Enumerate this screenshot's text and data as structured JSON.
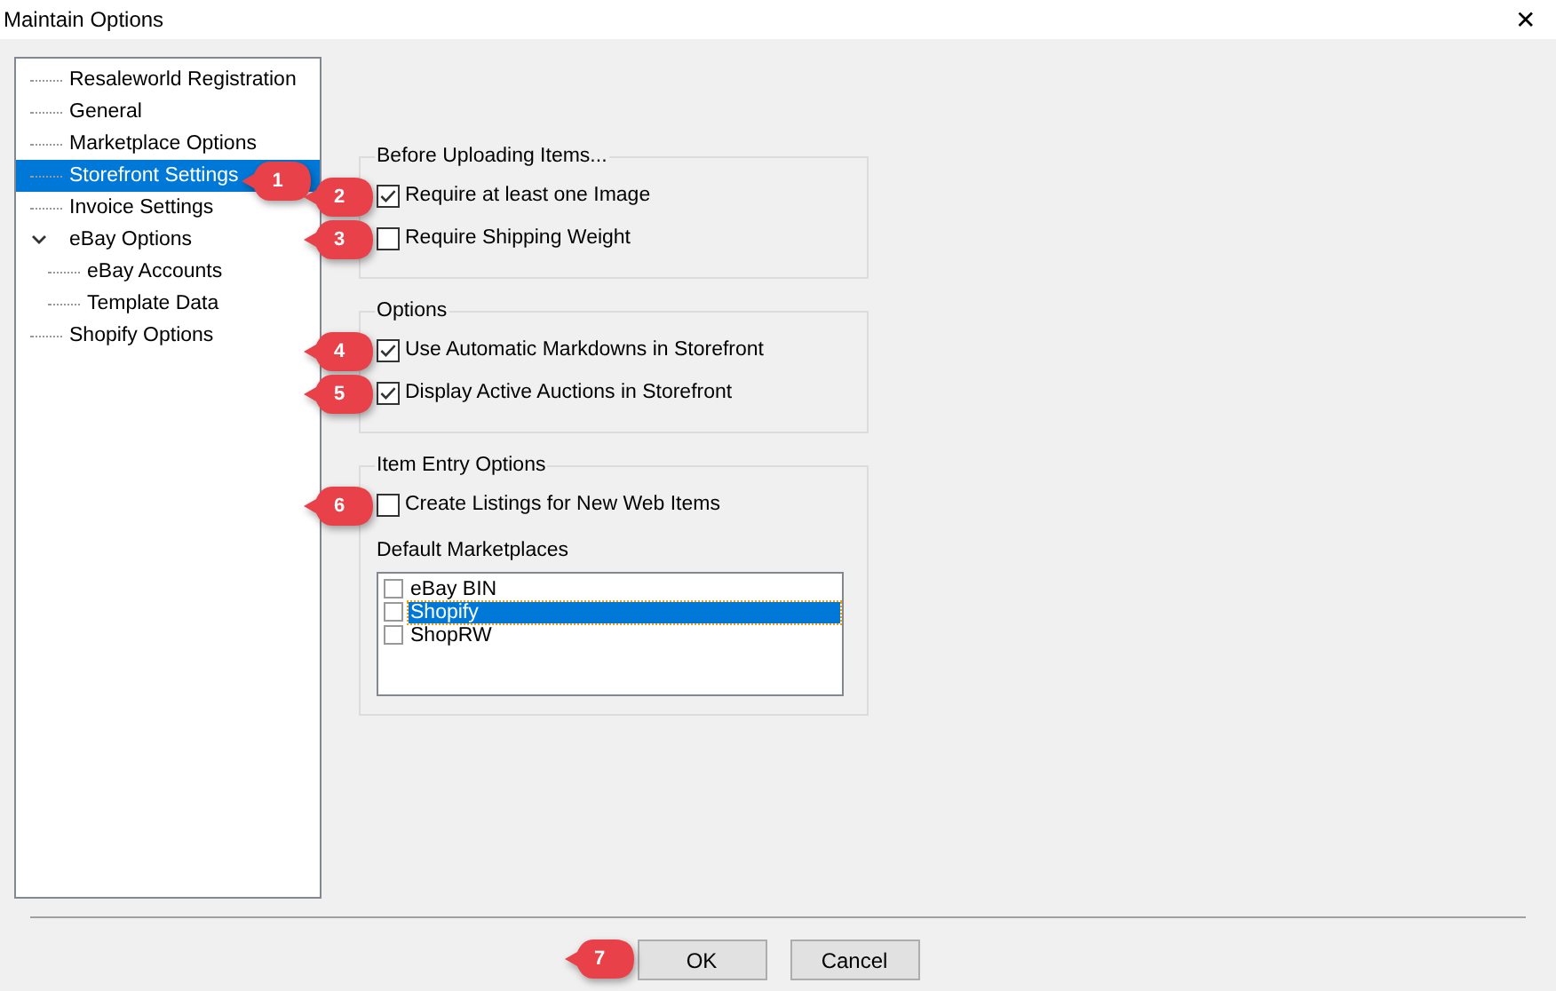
{
  "window": {
    "title": "Maintain Options",
    "close": "✕"
  },
  "tree": [
    {
      "label": "Resaleworld Registration",
      "selected": false
    },
    {
      "label": "General",
      "selected": false
    },
    {
      "label": "Marketplace Options",
      "selected": false
    },
    {
      "label": "Storefront Settings",
      "selected": true,
      "callout": "1"
    },
    {
      "label": "Invoice Settings",
      "selected": false
    },
    {
      "label": "eBay Options",
      "selected": false,
      "expanded": true,
      "children": [
        {
          "label": "eBay Accounts",
          "selected": false
        },
        {
          "label": "Template Data",
          "selected": false
        }
      ]
    },
    {
      "label": "Shopify Options",
      "selected": false
    }
  ],
  "groups": [
    {
      "title": "Before Uploading Items...",
      "options": [
        {
          "label": "Require at least one Image",
          "checked": true,
          "callout": "2"
        },
        {
          "label": "Require Shipping Weight",
          "checked": false,
          "callout": "3"
        }
      ]
    },
    {
      "title": "Options",
      "options": [
        {
          "label": "Use Automatic Markdowns in Storefront",
          "checked": true,
          "callout": "4"
        },
        {
          "label": "Display Active Auctions in Storefront",
          "checked": true,
          "callout": "5"
        }
      ]
    },
    {
      "title": "Item Entry Options",
      "options": [
        {
          "label": "Create Listings for New Web Items",
          "checked": false,
          "callout": "6"
        }
      ],
      "list_label": "Default Marketplaces",
      "list": [
        {
          "label": "eBay BIN",
          "checked": false,
          "selected": false
        },
        {
          "label": "Shopify",
          "checked": false,
          "selected": true
        },
        {
          "label": "ShopRW",
          "checked": false,
          "selected": false
        }
      ]
    }
  ],
  "buttons": [
    {
      "label": "OK",
      "callout": "7"
    },
    {
      "label": "Cancel"
    }
  ]
}
